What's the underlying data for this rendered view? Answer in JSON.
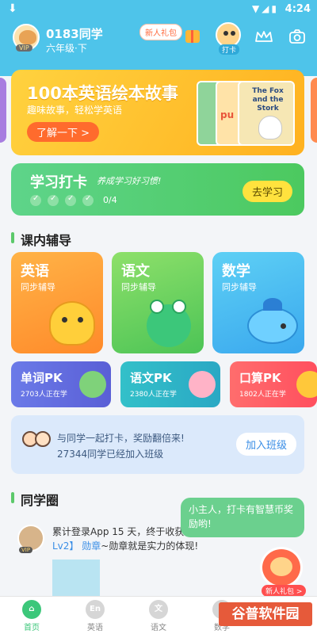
{
  "status_bar": {
    "time": "4:24"
  },
  "user": {
    "name": "0183同学",
    "grade": "六年级·下",
    "vip": "VIP"
  },
  "header": {
    "gift_badge": "新人礼包",
    "checkin_label": "打卡"
  },
  "banner": {
    "title": "100本英语绘本故事",
    "subtitle": "趣味故事，轻松学英语",
    "button": "了解一下 >",
    "book_title": "The Fox and the Stork",
    "book2_text": "pu"
  },
  "checkin": {
    "title": "学习打卡",
    "slogan": "养成学习好习惯!",
    "count": "0/4",
    "button": "去学习"
  },
  "tutoring": {
    "title": "课内辅导",
    "subjects": [
      {
        "name": "英语",
        "sub": "同步辅导"
      },
      {
        "name": "语文",
        "sub": "同步辅导"
      },
      {
        "name": "数学",
        "sub": "同步辅导"
      }
    ],
    "pk": [
      {
        "name": "单词PK",
        "count": "2703人正在学"
      },
      {
        "name": "语文PK",
        "count": "2380人正在学"
      },
      {
        "name": "口算PK",
        "count": "1802人正在学"
      }
    ]
  },
  "join_class": {
    "line1": "与同学一起打卡，奖励翻倍来!",
    "line2": "27344同学已经加入班级",
    "button": "加入班级"
  },
  "circle": {
    "title": "同学圈",
    "post_text": "累计登录App 15 天，终于收获",
    "post_level": "Lv2】",
    "post_badge": "勋章",
    "post_tail": "~勋章就是实力的体现!",
    "vip": "VIP"
  },
  "tip": {
    "text": "小主人，打卡有智慧币奖励哟!",
    "gift": "新人礼包 >"
  },
  "tabs": [
    {
      "label": "首页",
      "icon_text": "⌂"
    },
    {
      "label": "英语",
      "icon_text": "En"
    },
    {
      "label": "语文",
      "icon_text": "文"
    },
    {
      "label": "数学",
      "icon_text": "+"
    }
  ],
  "watermark": "谷普软件园",
  "colors": {
    "header": "#4ec4ea",
    "accent_green": "#3cc77a",
    "banner": "#ffc62e"
  }
}
